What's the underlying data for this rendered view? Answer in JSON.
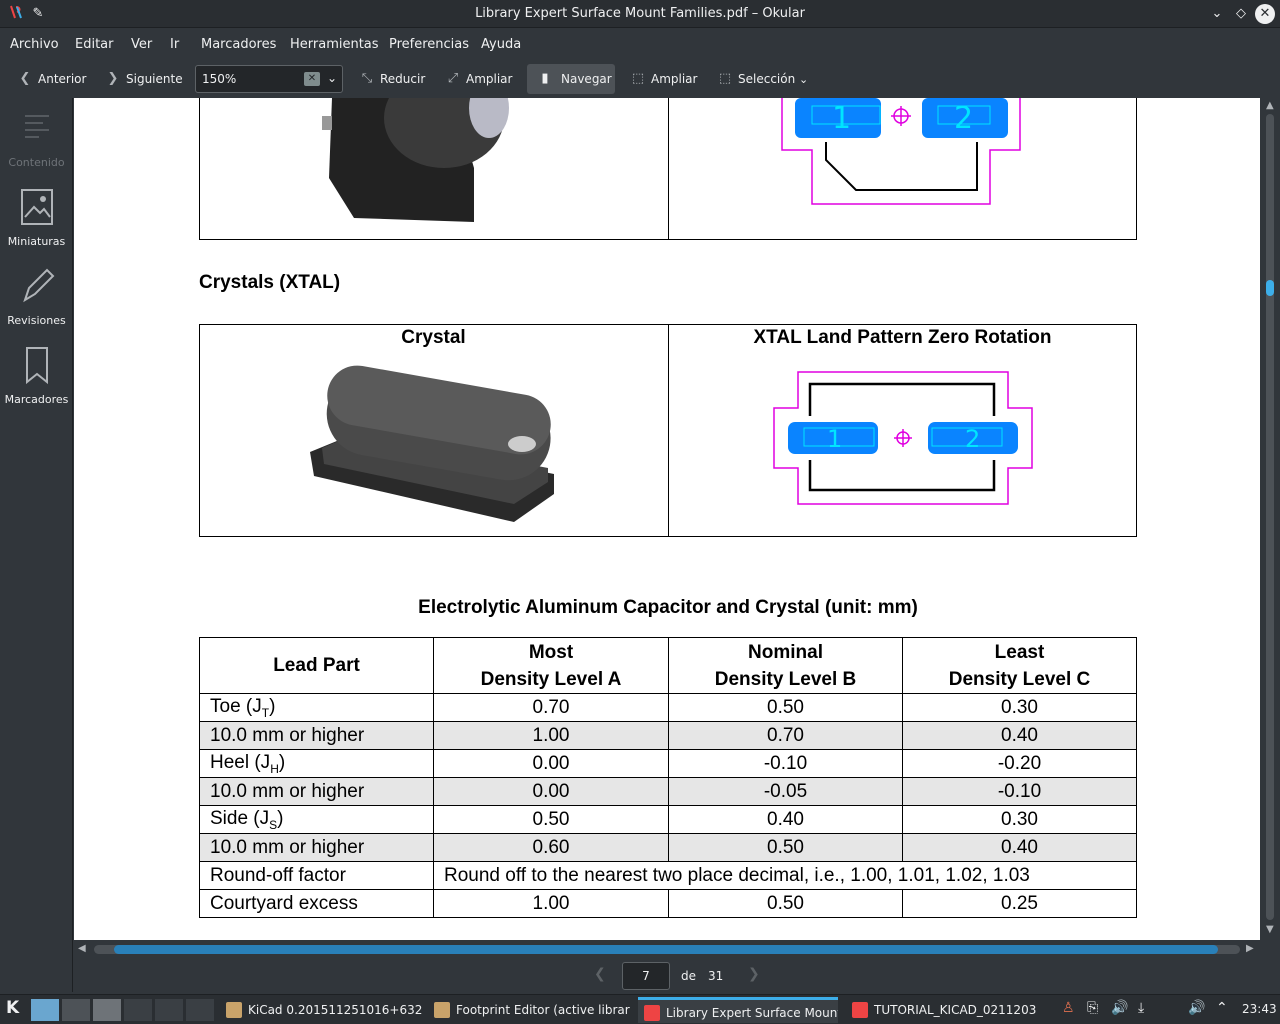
{
  "window": {
    "title": "Library Expert Surface Mount Families.pdf – Okular"
  },
  "menu": [
    "Archivo",
    "Editar",
    "Ver",
    "Ir",
    "Marcadores",
    "Herramientas",
    "Preferencias",
    "Ayuda"
  ],
  "toolbar": {
    "prev": "Anterior",
    "next": "Siguiente",
    "zoom": "150%",
    "zoom_out": "Reducir",
    "zoom_in": "Ampliar",
    "browse": "Navegar",
    "zoom_tool": "Ampliar",
    "selection": "Selección"
  },
  "sidebar": [
    "Contenido",
    "Miniaturas",
    "Revisiones",
    "Marcadores"
  ],
  "document": {
    "section_title": "Crystals (XTAL)",
    "crystal_header": "Crystal",
    "xtal_header": "XTAL Land Pattern Zero Rotation",
    "pad1": "1",
    "pad2": "2",
    "table_title": "Electrolytic Aluminum Capacitor and Crystal (unit: mm)",
    "table": {
      "headers": [
        "Lead Part",
        "Most\nDensity Level A",
        "Nominal\nDensity Level B",
        "Least\nDensity Level C"
      ],
      "rows": [
        {
          "label": "Toe (J",
          "sub": "T",
          "post": ")",
          "values": [
            "0.70",
            "0.50",
            "0.30"
          ]
        },
        {
          "label": "10.0 mm or higher",
          "values": [
            "1.00",
            "0.70",
            "0.40"
          ]
        },
        {
          "label": "Heel (J",
          "sub": "H",
          "post": ")",
          "values": [
            "0.00",
            "-0.10",
            "-0.20"
          ]
        },
        {
          "label": "10.0 mm or higher",
          "values": [
            "0.00",
            "-0.05",
            "-0.10"
          ]
        },
        {
          "label": "Side (J",
          "sub": "S",
          "post": ")",
          "values": [
            "0.50",
            "0.40",
            "0.30"
          ]
        },
        {
          "label": "10.0 mm or higher",
          "values": [
            "0.60",
            "0.50",
            "0.40"
          ]
        }
      ],
      "roundoff_label": "Round-off factor",
      "roundoff_text": "Round off to the nearest two place decimal, i.e., 1.00, 1.01, 1.02, 1.03",
      "courtyard_label": "Courtyard excess",
      "courtyard_values": [
        "1.00",
        "0.50",
        "0.25"
      ]
    }
  },
  "nav": {
    "page": "7",
    "of": "de",
    "total": "31"
  },
  "taskbar": {
    "tasks": [
      "KiCad 0.201511251016+632",
      "Footprint Editor (active librar",
      "Library Expert Surface Mount",
      "TUTORIAL_KICAD_0211203"
    ],
    "clock": "23:43"
  },
  "colors": {
    "accent": "#3daee9",
    "pad": "#0a84ff",
    "outline": "#e000e0"
  }
}
